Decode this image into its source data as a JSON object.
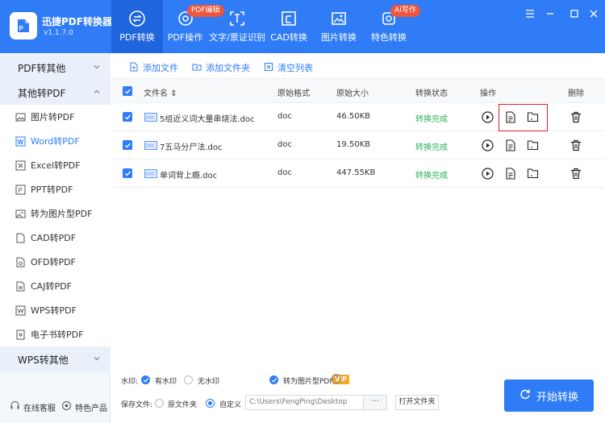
{
  "app": {
    "title": "迅捷PDF转换器",
    "version": "v1.1.7.0"
  },
  "nav": {
    "tabs": [
      {
        "label": "PDF转换",
        "icon": "pdf-convert-icon",
        "active": true
      },
      {
        "label": "PDF操作",
        "icon": "pdf-operation-icon",
        "badge": "PDF编辑"
      },
      {
        "label": "文字/票证识别",
        "icon": "ocr-icon"
      },
      {
        "label": "CAD转换",
        "icon": "cad-icon"
      },
      {
        "label": "图片转换",
        "icon": "image-icon"
      },
      {
        "label": "特色转换",
        "icon": "special-icon",
        "badge": "AI写作"
      }
    ]
  },
  "sidebar": {
    "group_pdf_to_other": "PDF转其他",
    "group_other_to_pdf": "其他转PDF",
    "items": [
      {
        "label": "图片转PDF",
        "icon": "image-icon"
      },
      {
        "label": "Word转PDF",
        "icon": "word-icon",
        "active": true
      },
      {
        "label": "Excel转PDF",
        "icon": "excel-icon"
      },
      {
        "label": "PPT转PDF",
        "icon": "ppt-icon"
      },
      {
        "label": "转为图片型PDF",
        "icon": "image-pdf-icon"
      },
      {
        "label": "CAD转PDF",
        "icon": "cad-icon"
      },
      {
        "label": "OFD转PDF",
        "icon": "ofd-icon"
      },
      {
        "label": "CAJ转PDF",
        "icon": "caj-icon"
      },
      {
        "label": "WPS转PDF",
        "icon": "wps-icon"
      },
      {
        "label": "电子书转PDF",
        "icon": "ebook-icon"
      }
    ],
    "group_wps_to_other": "WPS转其他",
    "footer": {
      "service": "在线客服",
      "products": "特色产品"
    }
  },
  "toolbar": {
    "add_file": "添加文件",
    "add_folder": "添加文件夹",
    "clear_list": "清空列表"
  },
  "table": {
    "headers": {
      "name": "文件名",
      "format": "原始格式",
      "size": "原始大小",
      "status": "转换状态",
      "action": "操作",
      "delete": "删除"
    },
    "sort_indicator": "⇕",
    "rows": [
      {
        "name": "5组近义词大量串烧法.doc",
        "format": "doc",
        "size": "46.50KB",
        "status": "转换完成"
      },
      {
        "name": "7五马分尸法.doc",
        "format": "doc",
        "size": "19.50KB",
        "status": "转换完成"
      },
      {
        "name": "单词背上瘾.doc",
        "format": "doc",
        "size": "447.55KB",
        "status": "转换完成"
      }
    ]
  },
  "bottom": {
    "watermark_label": "水印:",
    "with_watermark": "有水印",
    "no_watermark": "无水印",
    "vip": "VIP",
    "to_image_pdf": "转为图片型PDF",
    "help": "?",
    "save_label": "保存文件:",
    "original_folder": "原文件夹",
    "custom": "自定义",
    "path": "C:\\Users\\FengPing\\Desktop",
    "browse": "···",
    "open_folder": "打开文件夹",
    "start": "开始转换"
  },
  "colors": {
    "accent": "#2f7cf6",
    "success": "#2db15a",
    "badge": "#f0553c",
    "vip": "#f5a623",
    "highlight": "#e02020"
  }
}
